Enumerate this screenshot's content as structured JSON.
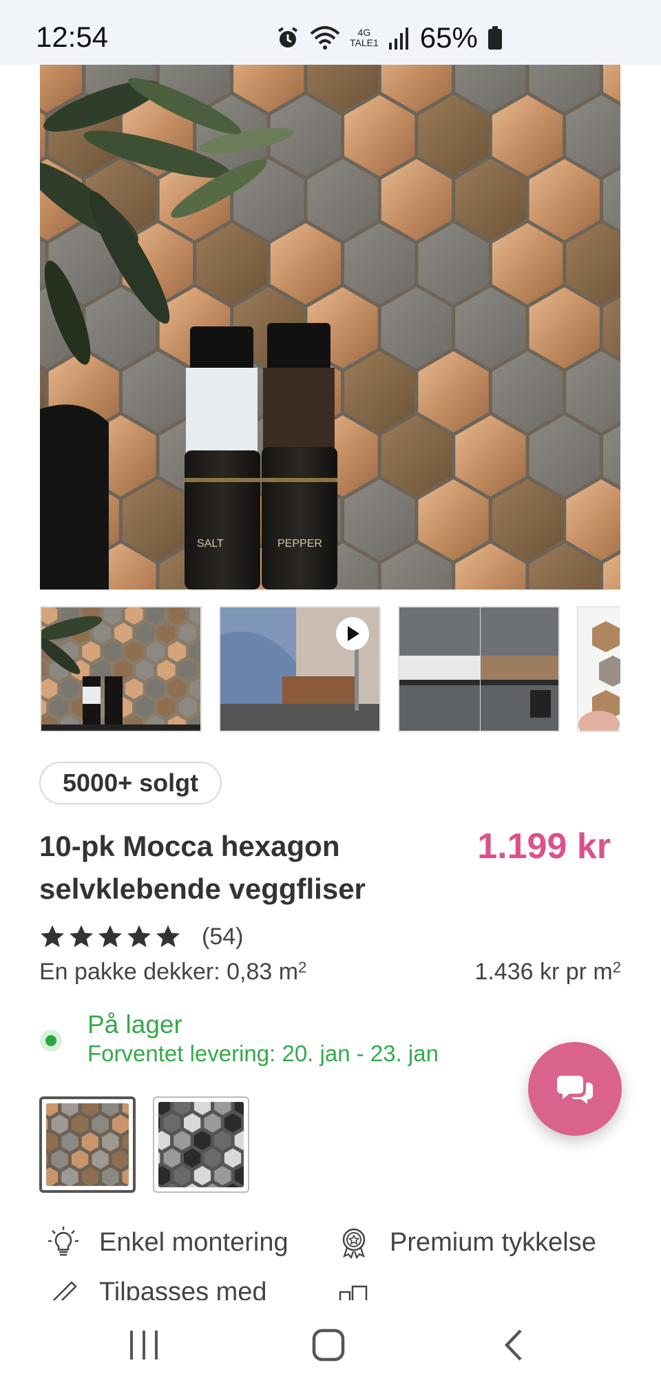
{
  "status_bar": {
    "time": "12:54",
    "network_top": "4G",
    "network_bottom": "TALE1",
    "battery": "65%"
  },
  "product": {
    "sold_badge": "5000+ solgt",
    "title": "10-pk Mocca hexagon selvklebende veggfliser",
    "price": "1.199 kr",
    "rating_stars": 5,
    "review_count": "(54)",
    "coverage_label": "En pakke dekker: 0,83 m",
    "coverage_sup": "2",
    "price_per_unit": "1.436 kr pr m",
    "price_per_unit_sup": "2",
    "stock_status": "På lager",
    "delivery": "Forventet levering: 20. jan - 23. jan"
  },
  "hero": {
    "salt_label": "SALT",
    "pepper_label": "PEPPER"
  },
  "features": [
    {
      "icon": "lightbulb-icon",
      "label": "Enkel montering"
    },
    {
      "icon": "award-badge-icon",
      "label": "Premium tykkelse"
    },
    {
      "icon": "ruler-pencil-icon",
      "label": "Tilpasses med"
    },
    {
      "icon": "building-icon",
      "label": ""
    }
  ],
  "colors": {
    "price": "#d9528c",
    "stock_green": "#35a94a",
    "chat_button": "#d9638d"
  },
  "icons": {
    "chat": "chat-bubbles-icon",
    "play": "play-icon",
    "nav_recent": "recent-apps-icon",
    "nav_home": "home-icon",
    "nav_back": "back-icon"
  }
}
